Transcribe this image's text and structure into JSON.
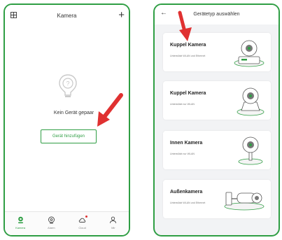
{
  "left_screen": {
    "header": {
      "title": "Kamera"
    },
    "empty_text": "Kein Gerät gepaar",
    "add_button": "Gerät hinzufügen",
    "tabs": [
      {
        "label": "Kamera",
        "icon": "camera-tab-icon",
        "active": true
      },
      {
        "label": "Alarm",
        "icon": "alarm-tab-icon",
        "active": false
      },
      {
        "label": "Cloud",
        "icon": "cloud-tab-icon",
        "active": false,
        "badge": true
      },
      {
        "label": "Mir",
        "icon": "user-tab-icon",
        "active": false
      }
    ]
  },
  "right_screen": {
    "header": {
      "title": "Gerätetyp auswählen"
    },
    "cards": [
      {
        "title": "Kuppel Kamera",
        "subtitle": "Unterstützt WLAN und Ethernet",
        "device": "dome-camera-ethernet"
      },
      {
        "title": "Kuppel Kamera",
        "subtitle": "Unterstützt nur WLAN",
        "device": "dome-camera-wlan"
      },
      {
        "title": "Innen Kamera",
        "subtitle": "Unterstützt nur WLAN",
        "device": "indoor-camera"
      },
      {
        "title": "Außenkamera",
        "subtitle": "Unterstützt WLAN und Ethernet",
        "device": "outdoor-bullet-camera"
      }
    ]
  },
  "colors": {
    "accent": "#2f9e44",
    "arrow": "#e03131"
  }
}
